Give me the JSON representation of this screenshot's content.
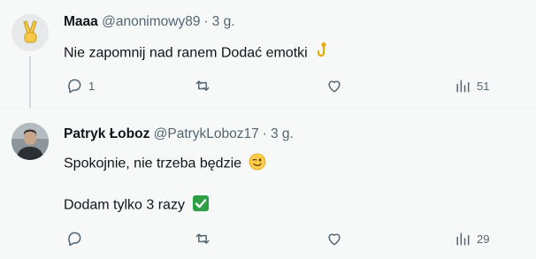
{
  "tweet1": {
    "name": "Maaa",
    "handle": "@anonimowy89",
    "separator": "·",
    "time": "3 g.",
    "text": "Nie zapomnij nad ranem Dodać emotki",
    "avatar_emoji": "✌️",
    "inline_emoji": "hook",
    "replies": "1",
    "retweets": "",
    "likes": "",
    "views": "51"
  },
  "tweet2": {
    "name": "Patryk Łoboz",
    "handle": "@PatrykLoboz17",
    "separator": "·",
    "time": "3 g.",
    "line1": "Spokojnie, nie trzeba będzie",
    "line2": "Dodam tylko 3 razy",
    "inline_emoji_1": "winking-face",
    "inline_emoji_2": "check-mark-button",
    "replies": "",
    "retweets": "",
    "likes": "",
    "views": "29"
  },
  "colors": {
    "text_primary": "#0f1419",
    "text_secondary": "#536471",
    "background": "#f7f9f9",
    "thread_line": "#cfd9de",
    "check_green": "#2ea043"
  }
}
